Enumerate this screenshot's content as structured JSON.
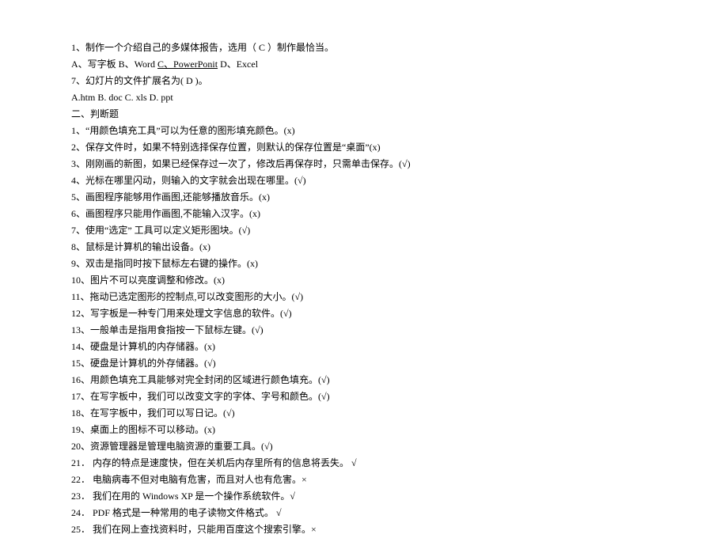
{
  "q1": {
    "line1_prefix": "1、制作一个介绍自己的多媒体报告，选用（   C   ）制作最恰当。",
    "line2_a": "A、写字板   B、Word    ",
    "line2_c": "C、PowerPonit",
    "line2_d": "    D、Excel"
  },
  "q7": {
    "stem": "7、幻灯片的文件扩展名为(    D )。",
    "opts": "A.htm   B. doc   C. xls   D. ppt"
  },
  "section2": "二、判断题",
  "tf": [
    " 1、“用颜色填充工具”可以为任意的图形填充颜色。(x)",
    "2、保存文件时，如果不特别选择保存位置，则默认的保存位置是“桌面”(x)",
    "3、刚刚画的新图，如果已经保存过一次了，修改后再保存时，只需单击保存。(√)",
    "4、光标在哪里闪动，则输入的文字就会出现在哪里。(√)",
    "5、画图程序能够用作画图,还能够播放音乐。(x)",
    "6、画图程序只能用作画图,不能输入汉字。(x)",
    "7、使用“选定” 工具可以定义矩形图块。(√)",
    "8、鼠标是计算机的输出设备。(x)",
    "9、双击是指同时按下鼠标左右键的操作。(x)",
    "10、图片不可以亮度调整和修改。(x)",
    "11、拖动已选定图形的控制点,可以改变图形的大小。(√)",
    "12、写字板是一种专门用来处理文字信息的软件。(√)",
    "13、一般单击是指用食指按一下鼠标左键。(√)",
    "14、硬盘是计算机的内存储器。(x)",
    "15、硬盘是计算机的外存储器。(√)",
    "16、用颜色填充工具能够对完全封闭的区域进行颜色填充。(√)",
    "17、在写字板中，我们可以改变文字的字体、字号和颜色。(√)",
    "18、在写字板中，我们可以写日记。(√)",
    "19、桌面上的图标不可以移动。(x)",
    "20、资源管理器是管理电脑资源的重要工具。(√)",
    "21．  内存的特点是速度快，但在关机后内存里所有的信息将丢失。 √",
    "22．  电脑病毒不但对电脑有危害，而且对人也有危害。×",
    "23．  我们在用的 Windows XP 是一个操作系统软件。√",
    "24．  PDF 格式是一种常用的电子读物文件格式。 √",
    "25．  我们在网上查找资料时，只能用百度这个搜索引擎。×"
  ]
}
